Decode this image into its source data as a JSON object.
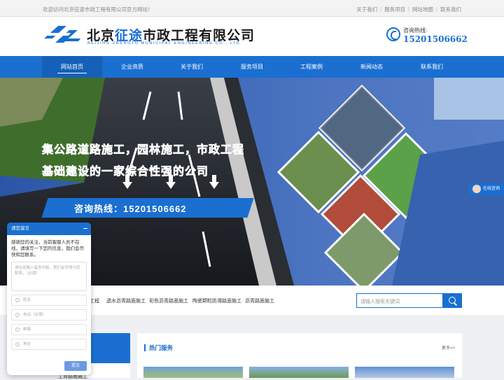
{
  "topbar": {
    "welcome": "欢迎访问北京征途市政工程有限公司官方网站！",
    "links": [
      "关于我们",
      "服务项目",
      "网站地图",
      "联系我们"
    ]
  },
  "header": {
    "brand_pre": "北京",
    "brand_hl": "征途",
    "brand_post": "市政工程有限公司",
    "brand_en": "BEIJING ZHENGTU MUNICIPAL ENGINEERING CO., LTD",
    "phone_label": "咨询热线:",
    "phone_number": "15201506662"
  },
  "nav": {
    "items": [
      "网站首页",
      "企业资质",
      "关于我们",
      "服务项目",
      "工程案例",
      "新闻动态",
      "联系我们"
    ],
    "active_index": 0
  },
  "banner": {
    "slogan_line1": "集公路道路施工，园林施工，市政工程",
    "slogan_line2": "基础建设的一家综合性强的公司",
    "hotline": "咨询热线：15201506662"
  },
  "online_tab": {
    "label": "在线咨询"
  },
  "hot_keywords": [
    "工程",
    "透水沥青路面施工",
    "彩色沥青路面施工",
    "陶瓷颗粒防滑路面施工",
    "沥青路面施工"
  ],
  "search": {
    "placeholder": "请输入搜索关键词"
  },
  "left_partial": {
    "label": "工青路面施工"
  },
  "hot_services": {
    "title": "热门服务",
    "more": "更多>>"
  },
  "chat": {
    "title": "请您留言",
    "message": "感谢您的关注，当前客服人员不在线，请填写一下您的信息，我们会尽快和您联系。",
    "textarea_placeholder": "请在此输入留言内容，我们会尽快与您联系。（必填）",
    "fields": [
      "姓名",
      "电话（必填）",
      "邮箱",
      "地址"
    ],
    "submit": "提交"
  },
  "colors": {
    "primary": "#1a6fd1",
    "nav_active": "#1560b8"
  }
}
